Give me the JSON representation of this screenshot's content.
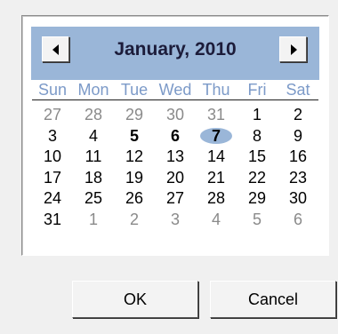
{
  "calendar": {
    "month_title": "January, 2010",
    "weekdays": [
      "Sun",
      "Mon",
      "Tue",
      "Wed",
      "Thu",
      "Fri",
      "Sat"
    ],
    "days": [
      {
        "label": "27",
        "other": true
      },
      {
        "label": "28",
        "other": true
      },
      {
        "label": "29",
        "other": true
      },
      {
        "label": "30",
        "other": true
      },
      {
        "label": "31",
        "other": true
      },
      {
        "label": "1"
      },
      {
        "label": "2"
      },
      {
        "label": "3"
      },
      {
        "label": "4"
      },
      {
        "label": "5",
        "bold": true
      },
      {
        "label": "6",
        "bold": true
      },
      {
        "label": "7",
        "bold": true,
        "selected": true
      },
      {
        "label": "8"
      },
      {
        "label": "9"
      },
      {
        "label": "10"
      },
      {
        "label": "11"
      },
      {
        "label": "12"
      },
      {
        "label": "13"
      },
      {
        "label": "14"
      },
      {
        "label": "15"
      },
      {
        "label": "16"
      },
      {
        "label": "17"
      },
      {
        "label": "18"
      },
      {
        "label": "19"
      },
      {
        "label": "20"
      },
      {
        "label": "21"
      },
      {
        "label": "22"
      },
      {
        "label": "23"
      },
      {
        "label": "24"
      },
      {
        "label": "25"
      },
      {
        "label": "26"
      },
      {
        "label": "27"
      },
      {
        "label": "28"
      },
      {
        "label": "29"
      },
      {
        "label": "30"
      },
      {
        "label": "31"
      },
      {
        "label": "1",
        "other": true
      },
      {
        "label": "2",
        "other": true
      },
      {
        "label": "3",
        "other": true
      },
      {
        "label": "4",
        "other": true
      },
      {
        "label": "5",
        "other": true
      },
      {
        "label": "6",
        "other": true
      }
    ],
    "prev_icon": "triangle-left-icon",
    "next_icon": "triangle-right-icon"
  },
  "buttons": {
    "ok_label": "OK",
    "cancel_label": "Cancel"
  },
  "colors": {
    "header_bg": "#9ab6d8",
    "weekday_text": "#7c9ac8",
    "other_month_text": "#8a8a8a",
    "selection": "#9ab6d8"
  }
}
